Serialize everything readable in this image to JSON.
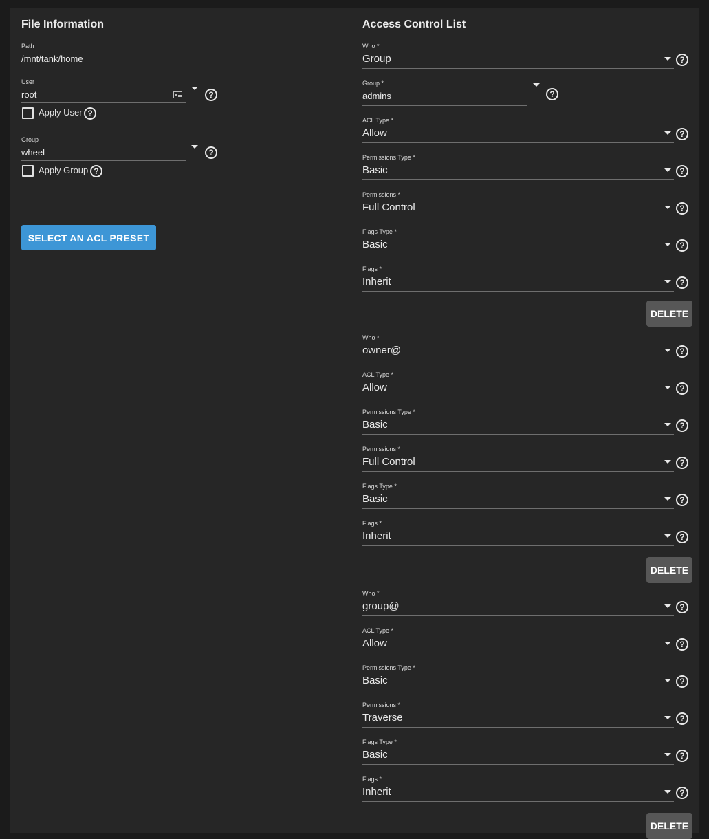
{
  "file_info": {
    "title": "File Information",
    "path": {
      "label": "Path",
      "value": "/mnt/tank/home"
    },
    "user": {
      "label": "User",
      "value": "root",
      "apply_label": "Apply User"
    },
    "group": {
      "label": "Group",
      "value": "wheel",
      "apply_label": "Apply Group"
    },
    "preset_button": "SELECT AN ACL PRESET"
  },
  "acl": {
    "title": "Access Control List",
    "delete_label": "DELETE",
    "entries": [
      {
        "who": {
          "label": "Who *",
          "value": "Group"
        },
        "group": {
          "label": "Group *",
          "value": "admins"
        },
        "acl_type": {
          "label": "ACL Type *",
          "value": "Allow"
        },
        "perm_type": {
          "label": "Permissions Type *",
          "value": "Basic"
        },
        "perms": {
          "label": "Permissions *",
          "value": "Full Control"
        },
        "flags_type": {
          "label": "Flags Type *",
          "value": "Basic"
        },
        "flags": {
          "label": "Flags *",
          "value": "Inherit"
        }
      },
      {
        "who": {
          "label": "Who *",
          "value": "owner@"
        },
        "acl_type": {
          "label": "ACL Type *",
          "value": "Allow"
        },
        "perm_type": {
          "label": "Permissions Type *",
          "value": "Basic"
        },
        "perms": {
          "label": "Permissions *",
          "value": "Full Control"
        },
        "flags_type": {
          "label": "Flags Type *",
          "value": "Basic"
        },
        "flags": {
          "label": "Flags *",
          "value": "Inherit"
        }
      },
      {
        "who": {
          "label": "Who *",
          "value": "group@"
        },
        "acl_type": {
          "label": "ACL Type *",
          "value": "Allow"
        },
        "perm_type": {
          "label": "Permissions Type *",
          "value": "Basic"
        },
        "perms": {
          "label": "Permissions *",
          "value": "Traverse"
        },
        "flags_type": {
          "label": "Flags Type *",
          "value": "Basic"
        },
        "flags": {
          "label": "Flags *",
          "value": "Inherit"
        }
      }
    ]
  },
  "icons": [
    "help-icon",
    "dropdown-arrow-icon",
    "contact-card-icon",
    "checkbox-icon"
  ]
}
